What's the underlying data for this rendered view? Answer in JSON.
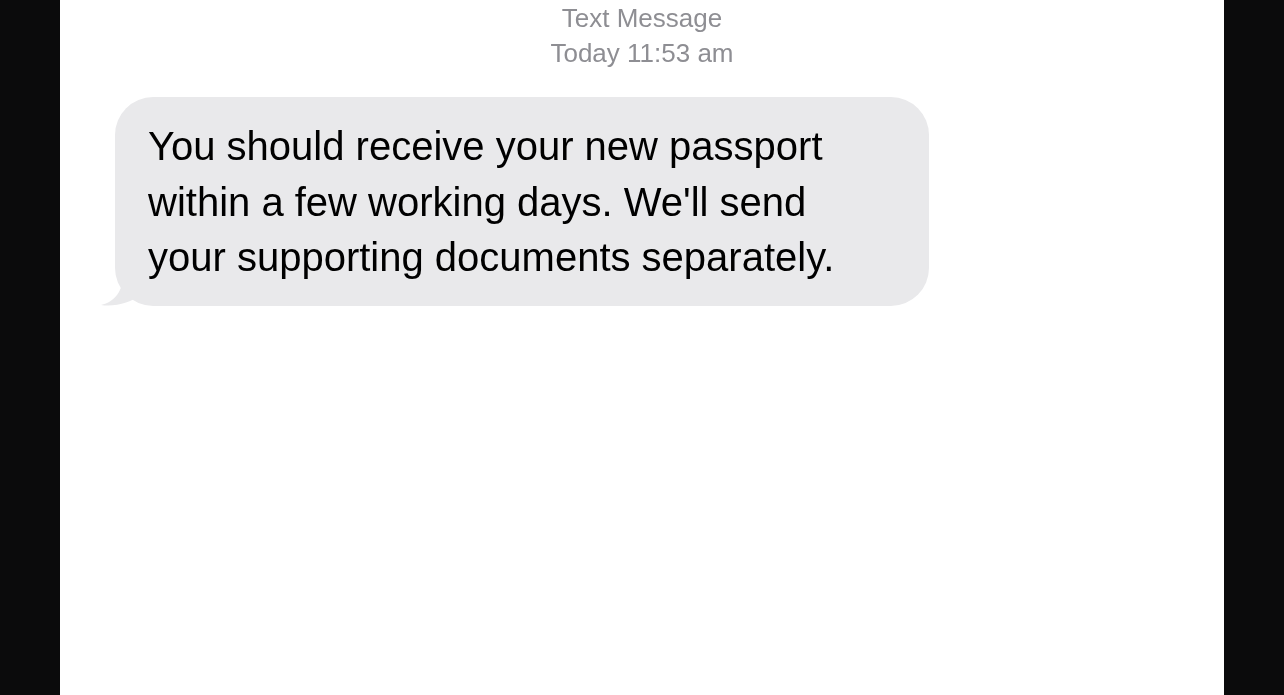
{
  "header": {
    "label": "Text Message",
    "timestamp": "Today 11:53 am"
  },
  "messages": [
    {
      "kind": "received",
      "text": "You should receive your new passport within a few working days. We'll send your supporting documents separately."
    }
  ]
}
